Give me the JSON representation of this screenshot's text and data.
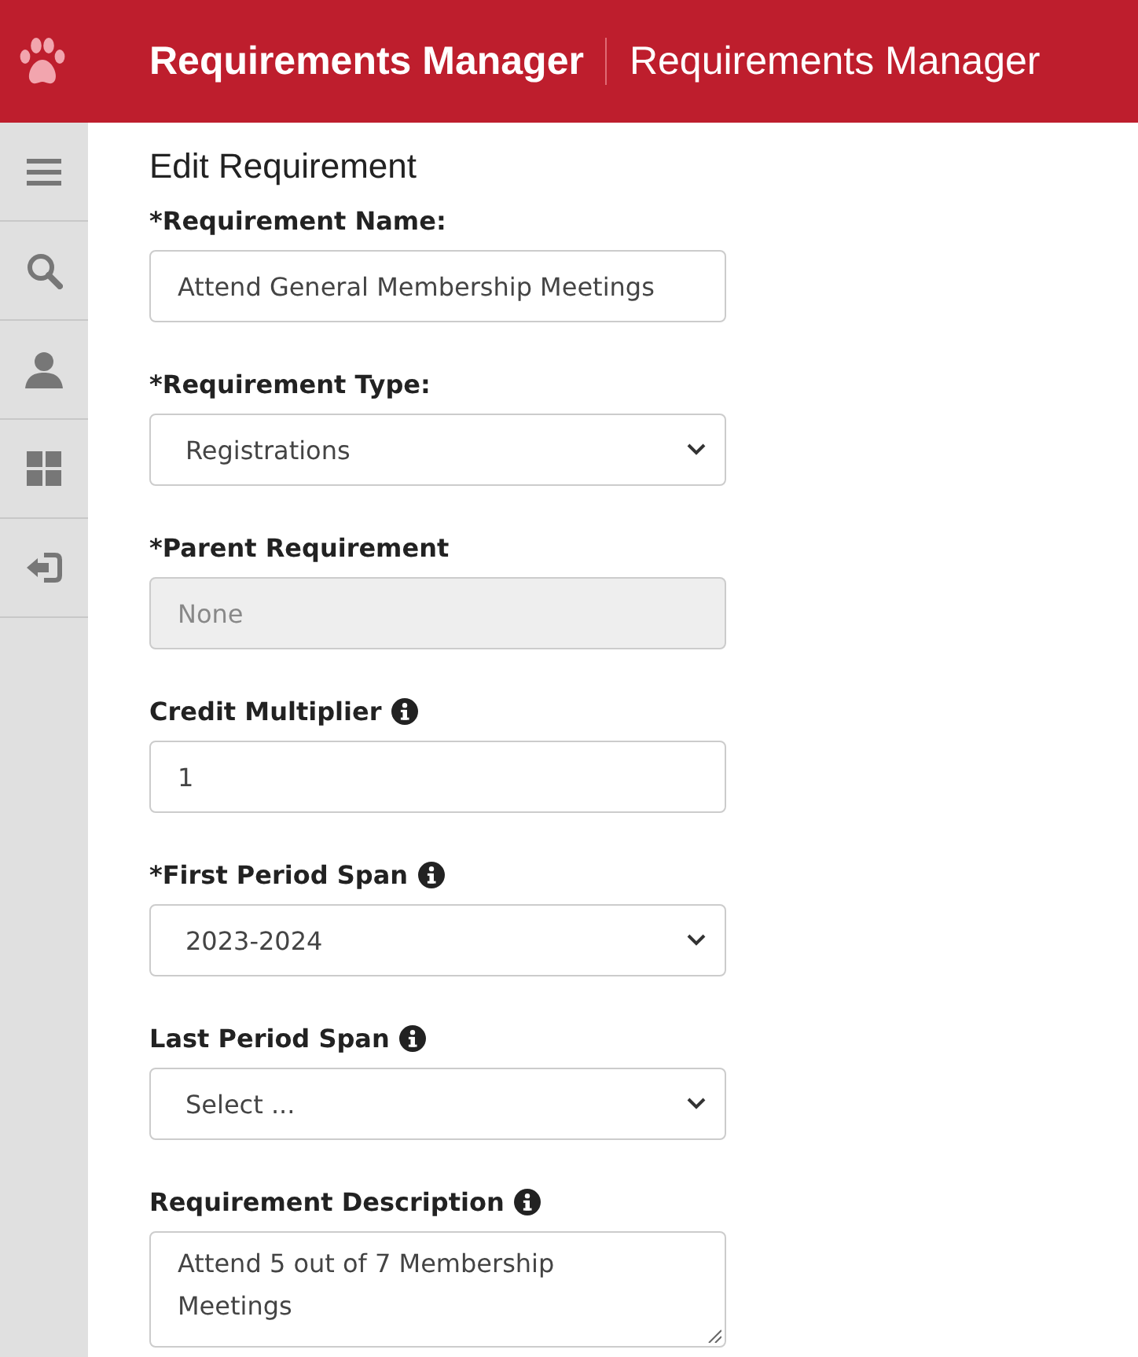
{
  "header": {
    "title": "Requirements Manager",
    "subtitle": "Requirements Manager"
  },
  "form": {
    "title": "Edit Requirement",
    "fields": [
      {
        "label": "*Requirement Name:",
        "kind": "text",
        "value": "Attend General Membership Meetings",
        "info": false,
        "disabled": false
      },
      {
        "label": "*Requirement Type:",
        "kind": "select",
        "value": "Registrations",
        "info": false,
        "disabled": false
      },
      {
        "label": "*Parent Requirement",
        "kind": "text",
        "value": "None",
        "info": false,
        "disabled": true
      },
      {
        "label": "Credit Multiplier",
        "kind": "text",
        "value": "1",
        "info": true,
        "disabled": false
      },
      {
        "label": "*First Period Span",
        "kind": "select",
        "value": "2023-2024",
        "info": true,
        "disabled": false
      },
      {
        "label": "Last Period Span",
        "kind": "select",
        "value": "Select ...",
        "info": true,
        "disabled": false
      },
      {
        "label": "Requirement Description",
        "kind": "textarea",
        "value": "Attend 5 out of 7 Membership Meetings",
        "info": true,
        "disabled": false
      }
    ]
  }
}
